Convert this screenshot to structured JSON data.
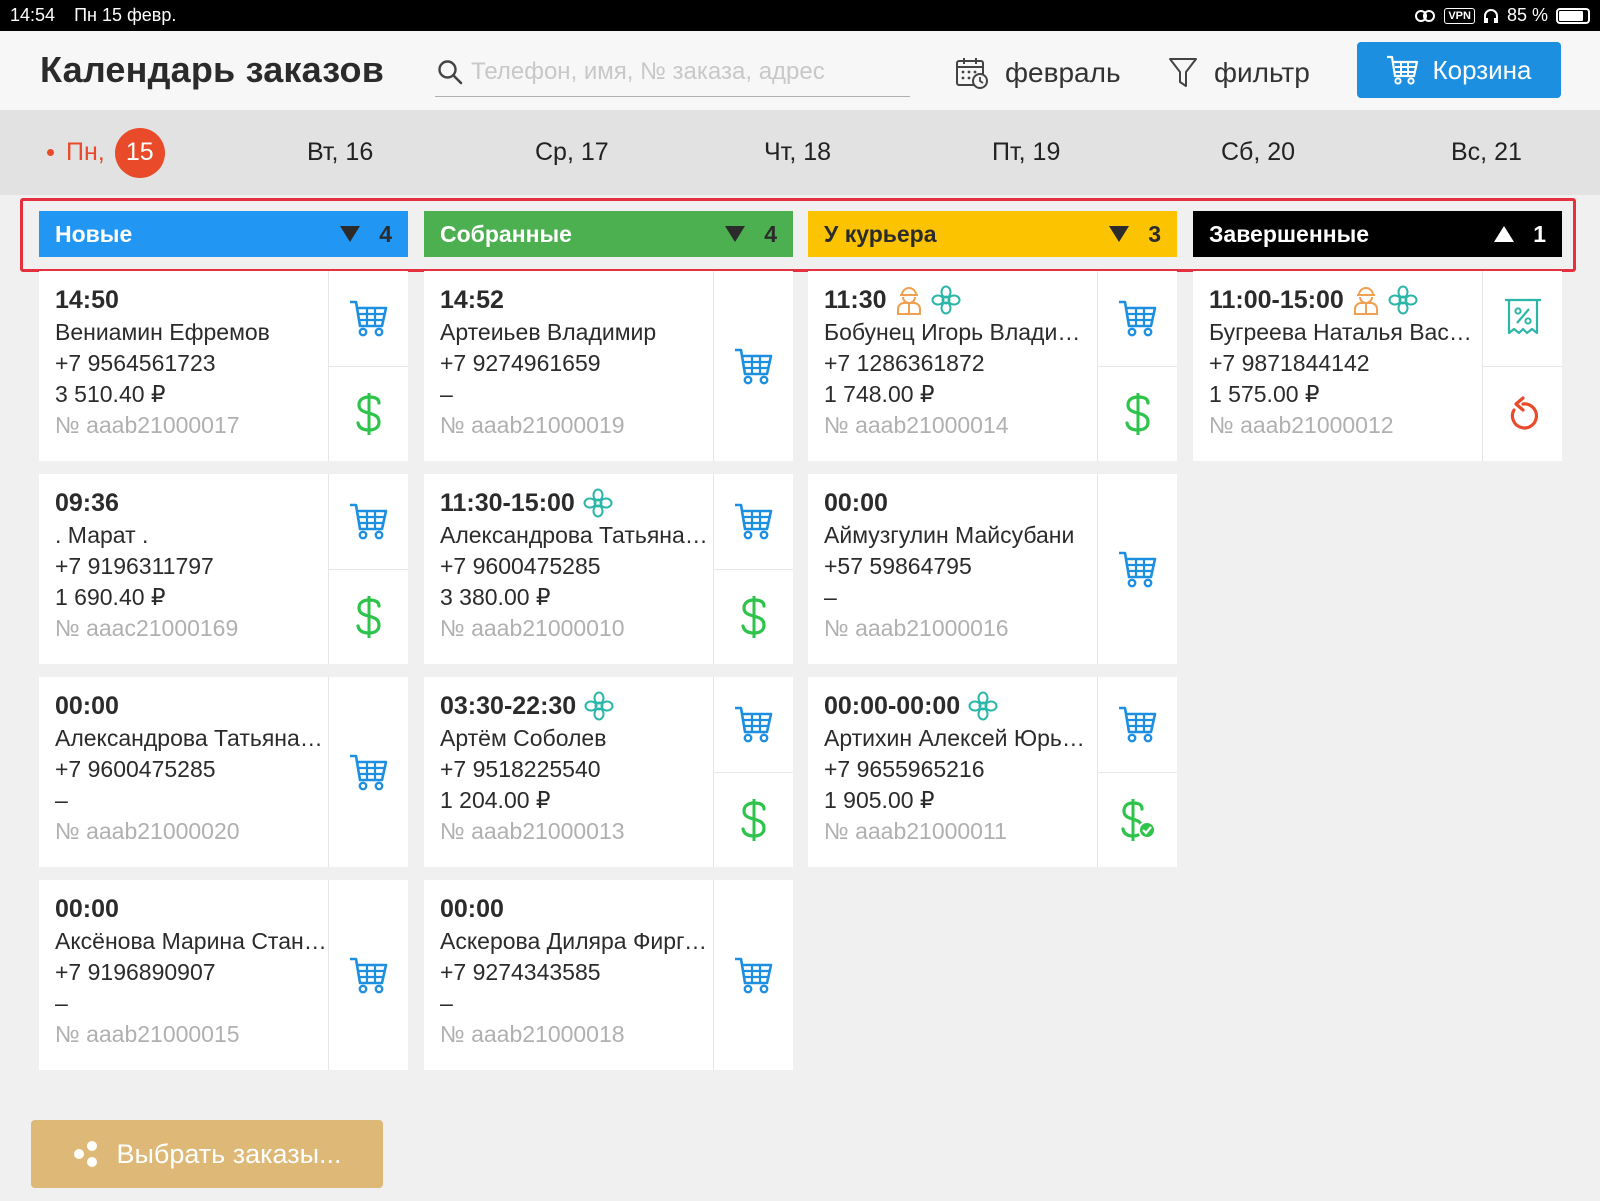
{
  "status_bar": {
    "time": "14:54",
    "date": "Пн 15 февр.",
    "vpn": "VPN",
    "battery": "85 %",
    "battery_level": 0.85
  },
  "header": {
    "title": "Календарь заказов",
    "search_placeholder": "Телефон, имя, № заказа, адрес",
    "month_label": "февраль",
    "filter_label": "фильтр",
    "cart_label": "Корзина"
  },
  "days": [
    {
      "label": "Пн,",
      "num": "15",
      "active": true
    },
    {
      "label": "Вт, 16"
    },
    {
      "label": "Ср, 17"
    },
    {
      "label": "Чт, 18"
    },
    {
      "label": "Пт, 19"
    },
    {
      "label": "Сб, 20"
    },
    {
      "label": "Вс, 21"
    }
  ],
  "columns": [
    {
      "title": "Новые",
      "count": "4",
      "color": "#2196f3",
      "arrow": "down"
    },
    {
      "title": "Собранные",
      "count": "4",
      "color": "#4caf50",
      "arrow": "down"
    },
    {
      "title": "У курьера",
      "count": "3",
      "color": "#fcc400",
      "arrow": "down"
    },
    {
      "title": "Завершенные",
      "count": "1",
      "color": "#000000",
      "arrow": "up"
    }
  ],
  "cards": [
    [
      {
        "time": "14:50",
        "name": "Вениамин Ефремов",
        "phone": "+7 9564561723",
        "sum": "3 510.40 ₽",
        "number": "№ aaab21000017",
        "actions": [
          "cart",
          "dollar"
        ]
      },
      {
        "time": "09:36",
        "name": ". Марат .",
        "phone": "+7 9196311797",
        "sum": "1 690.40 ₽",
        "number": "№ aaac21000169",
        "actions": [
          "cart",
          "dollar"
        ]
      },
      {
        "time": "00:00",
        "name": "Александрова Татьяна Владимировна",
        "phone": "+7 9600475285",
        "sum": "–",
        "number": "№ aaab21000020",
        "actions": [
          "cart"
        ]
      },
      {
        "time": "00:00",
        "name": "Аксёнова  Марина  Станиславовна",
        "phone": "+7 9196890907",
        "sum": "–",
        "number": "№ aaab21000015",
        "actions": [
          "cart"
        ]
      }
    ],
    [
      {
        "time": "14:52",
        "name": "Артеиьев Владимир",
        "phone": "+7 9274961659",
        "sum": "–",
        "number": "№ aaab21000019",
        "actions": [
          "cart"
        ]
      },
      {
        "time": "11:30-15:00",
        "flower": true,
        "name": "Александрова Татьяна Владимировна",
        "phone": "+7 9600475285",
        "sum": "3 380.00 ₽",
        "number": "№ aaab21000010",
        "actions": [
          "cart",
          "dollar"
        ]
      },
      {
        "time": "03:30-22:30",
        "flower": true,
        "name": "Артём Соболев",
        "phone": "+7 9518225540",
        "sum": "1 204.00 ₽",
        "number": "№ aaab21000013",
        "actions": [
          "cart",
          "dollar"
        ]
      },
      {
        "time": "00:00",
        "name": "Аскерова Диляра Фиргатовна",
        "phone": "+7 9274343585",
        "sum": "–",
        "number": "№ aaab21000018",
        "actions": [
          "cart"
        ]
      }
    ],
    [
      {
        "time": "11:30",
        "courier": true,
        "flower": true,
        "name": "Бобунец Игорь Владимирович",
        "phone": "+7 1286361872",
        "sum": "1 748.00 ₽",
        "number": "№ aaab21000014",
        "actions": [
          "cart",
          "dollar"
        ]
      },
      {
        "time": "00:00",
        "name": "Аймузгулин Майсубани",
        "phone": "+57 59864795",
        "sum": "–",
        "number": "№ aaab21000016",
        "actions": [
          "cart"
        ]
      },
      {
        "time": "00:00-00:00",
        "flower": true,
        "name": "Артихин  Алексей  Юрьевич",
        "phone": "+7 9655965216",
        "sum": "1 905.00 ₽",
        "number": "№ aaab21000011",
        "actions": [
          "cart",
          "dollar-check"
        ]
      }
    ],
    [
      {
        "time": "11:00-15:00",
        "courier": true,
        "flower": true,
        "name": "Бугреева Наталья Васильевна",
        "phone": "+7 9871844142",
        "sum": "1 575.00 ₽",
        "number": "№ aaab21000012",
        "actions": [
          "receipt-percent",
          "refresh"
        ]
      }
    ]
  ],
  "select_orders_label": "Выбрать заказы...",
  "colors": {
    "accent_blue": "#1d8fe1",
    "today_red": "#e84a2a",
    "select_gold": "#ddb876",
    "dollar_green": "#2ec44b",
    "flower_teal": "#2bb6a8",
    "courier_orange": "#f0a050"
  }
}
